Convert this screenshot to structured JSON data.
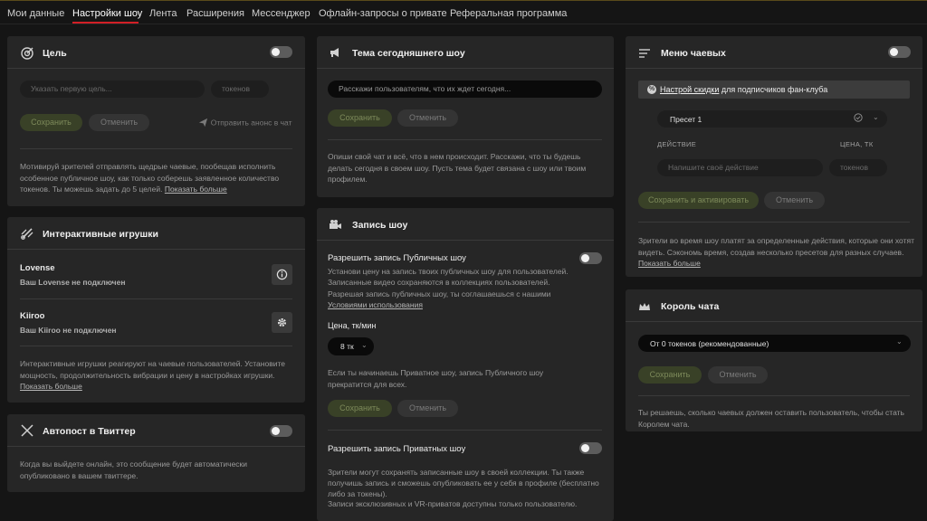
{
  "nav": {
    "items": [
      "Мои данные",
      "Настройки шоу",
      "Лента",
      "Расширения",
      "Мессенджер",
      "Офлайн-запросы о привате",
      "Реферальная программа"
    ],
    "active_index": 1
  },
  "goal": {
    "title": "Цель",
    "goal_placeholder": "Указать первую цель...",
    "tokens_placeholder": "токенов",
    "save": "Сохранить",
    "cancel": "Отменить",
    "send_announce": "Отправить анонс в чат",
    "desc": "Мотивируй зрителей отправлять щедрые чаевые, пообещав исполнить особенное публичное шоу, как только соберешь заявленное количество токенов. Ты можешь задать до 5 целей.",
    "show_more": "Показать больше"
  },
  "toys": {
    "title": "Интерактивные игрушки",
    "items": [
      {
        "name": "Lovense",
        "status": "Ваш Lovense не подключен"
      },
      {
        "name": "Kiiroo",
        "status": "Ваш Kiiroo не подключен"
      }
    ],
    "desc": "Интерактивные игрушки реагируют на чаевые пользователей. Установите мощность, продолжительность вибрации и цену в настройках игрушки.",
    "show_more": "Показать больше"
  },
  "twitter": {
    "title": "Автопост в Твиттер",
    "desc": "Когда вы выйдете онлайн, это сообщение будет автоматически опубликовано в вашем твиттере."
  },
  "topic": {
    "title": "Тема сегодняшнего шоу",
    "placeholder": "Расскажи пользователям, что их ждет сегодня...",
    "save": "Сохранить",
    "cancel": "Отменить",
    "desc": "Опиши свой чат и всё, что в нем происходит. Расскажи, что ты будешь делать сегодня в своем шоу. Пусть тема будет связана с шоу или твоим профилем."
  },
  "recording": {
    "title": "Запись шоу",
    "public_label": "Разрешить запись Публичных шоу",
    "public_desc": "Установи цену на запись твоих публичных шоу для пользователей. Записанные видео сохраняются в коллекциях пользователей. Разрешая запись публичных шоу, ты соглашаешься с нашими",
    "terms_link": "Условиями использования",
    "price_label": "Цена, тк/мин",
    "price_value": "8 тк",
    "private_note": "Если ты начинаешь Приватное шоу, запись Публичного шоу прекратится для всех.",
    "save": "Сохранить",
    "cancel": "Отменить",
    "private_label": "Разрешить запись Приватных шоу",
    "private_desc": "Зрители могут сохранять записанные шоу в своей коллекции. Ты также получишь запись и сможешь опубликовать ее у себя в профиле (бесплатно либо за токены).",
    "vr_note": "Записи эксклюзивных и VR-приватов доступны только пользователю."
  },
  "tips_menu": {
    "title": "Меню чаевых",
    "discount_link": "Настрой скидки",
    "discount_text": "для подписчиков фан-клуба",
    "preset": "Пресет 1",
    "col_action": "ДЕЙСТВИЕ",
    "col_price": "ЦЕНА, ТК",
    "action_placeholder": "Напишите своё действие",
    "tokens_placeholder": "токенов",
    "save_activate": "Сохранить и активировать",
    "cancel": "Отменить",
    "desc": "Зрители во время шоу платят за определенные действия, которые они хотят видеть. Сэкономь время, создав несколько пресетов для разных случаев.",
    "show_more": "Показать больше"
  },
  "king": {
    "title": "Король чата",
    "select_value": "От 0 токенов (рекомендованные)",
    "save": "Сохранить",
    "cancel": "Отменить",
    "desc": "Ты решаешь, сколько чаевых должен оставить пользователь, чтобы стать Королем чата."
  }
}
